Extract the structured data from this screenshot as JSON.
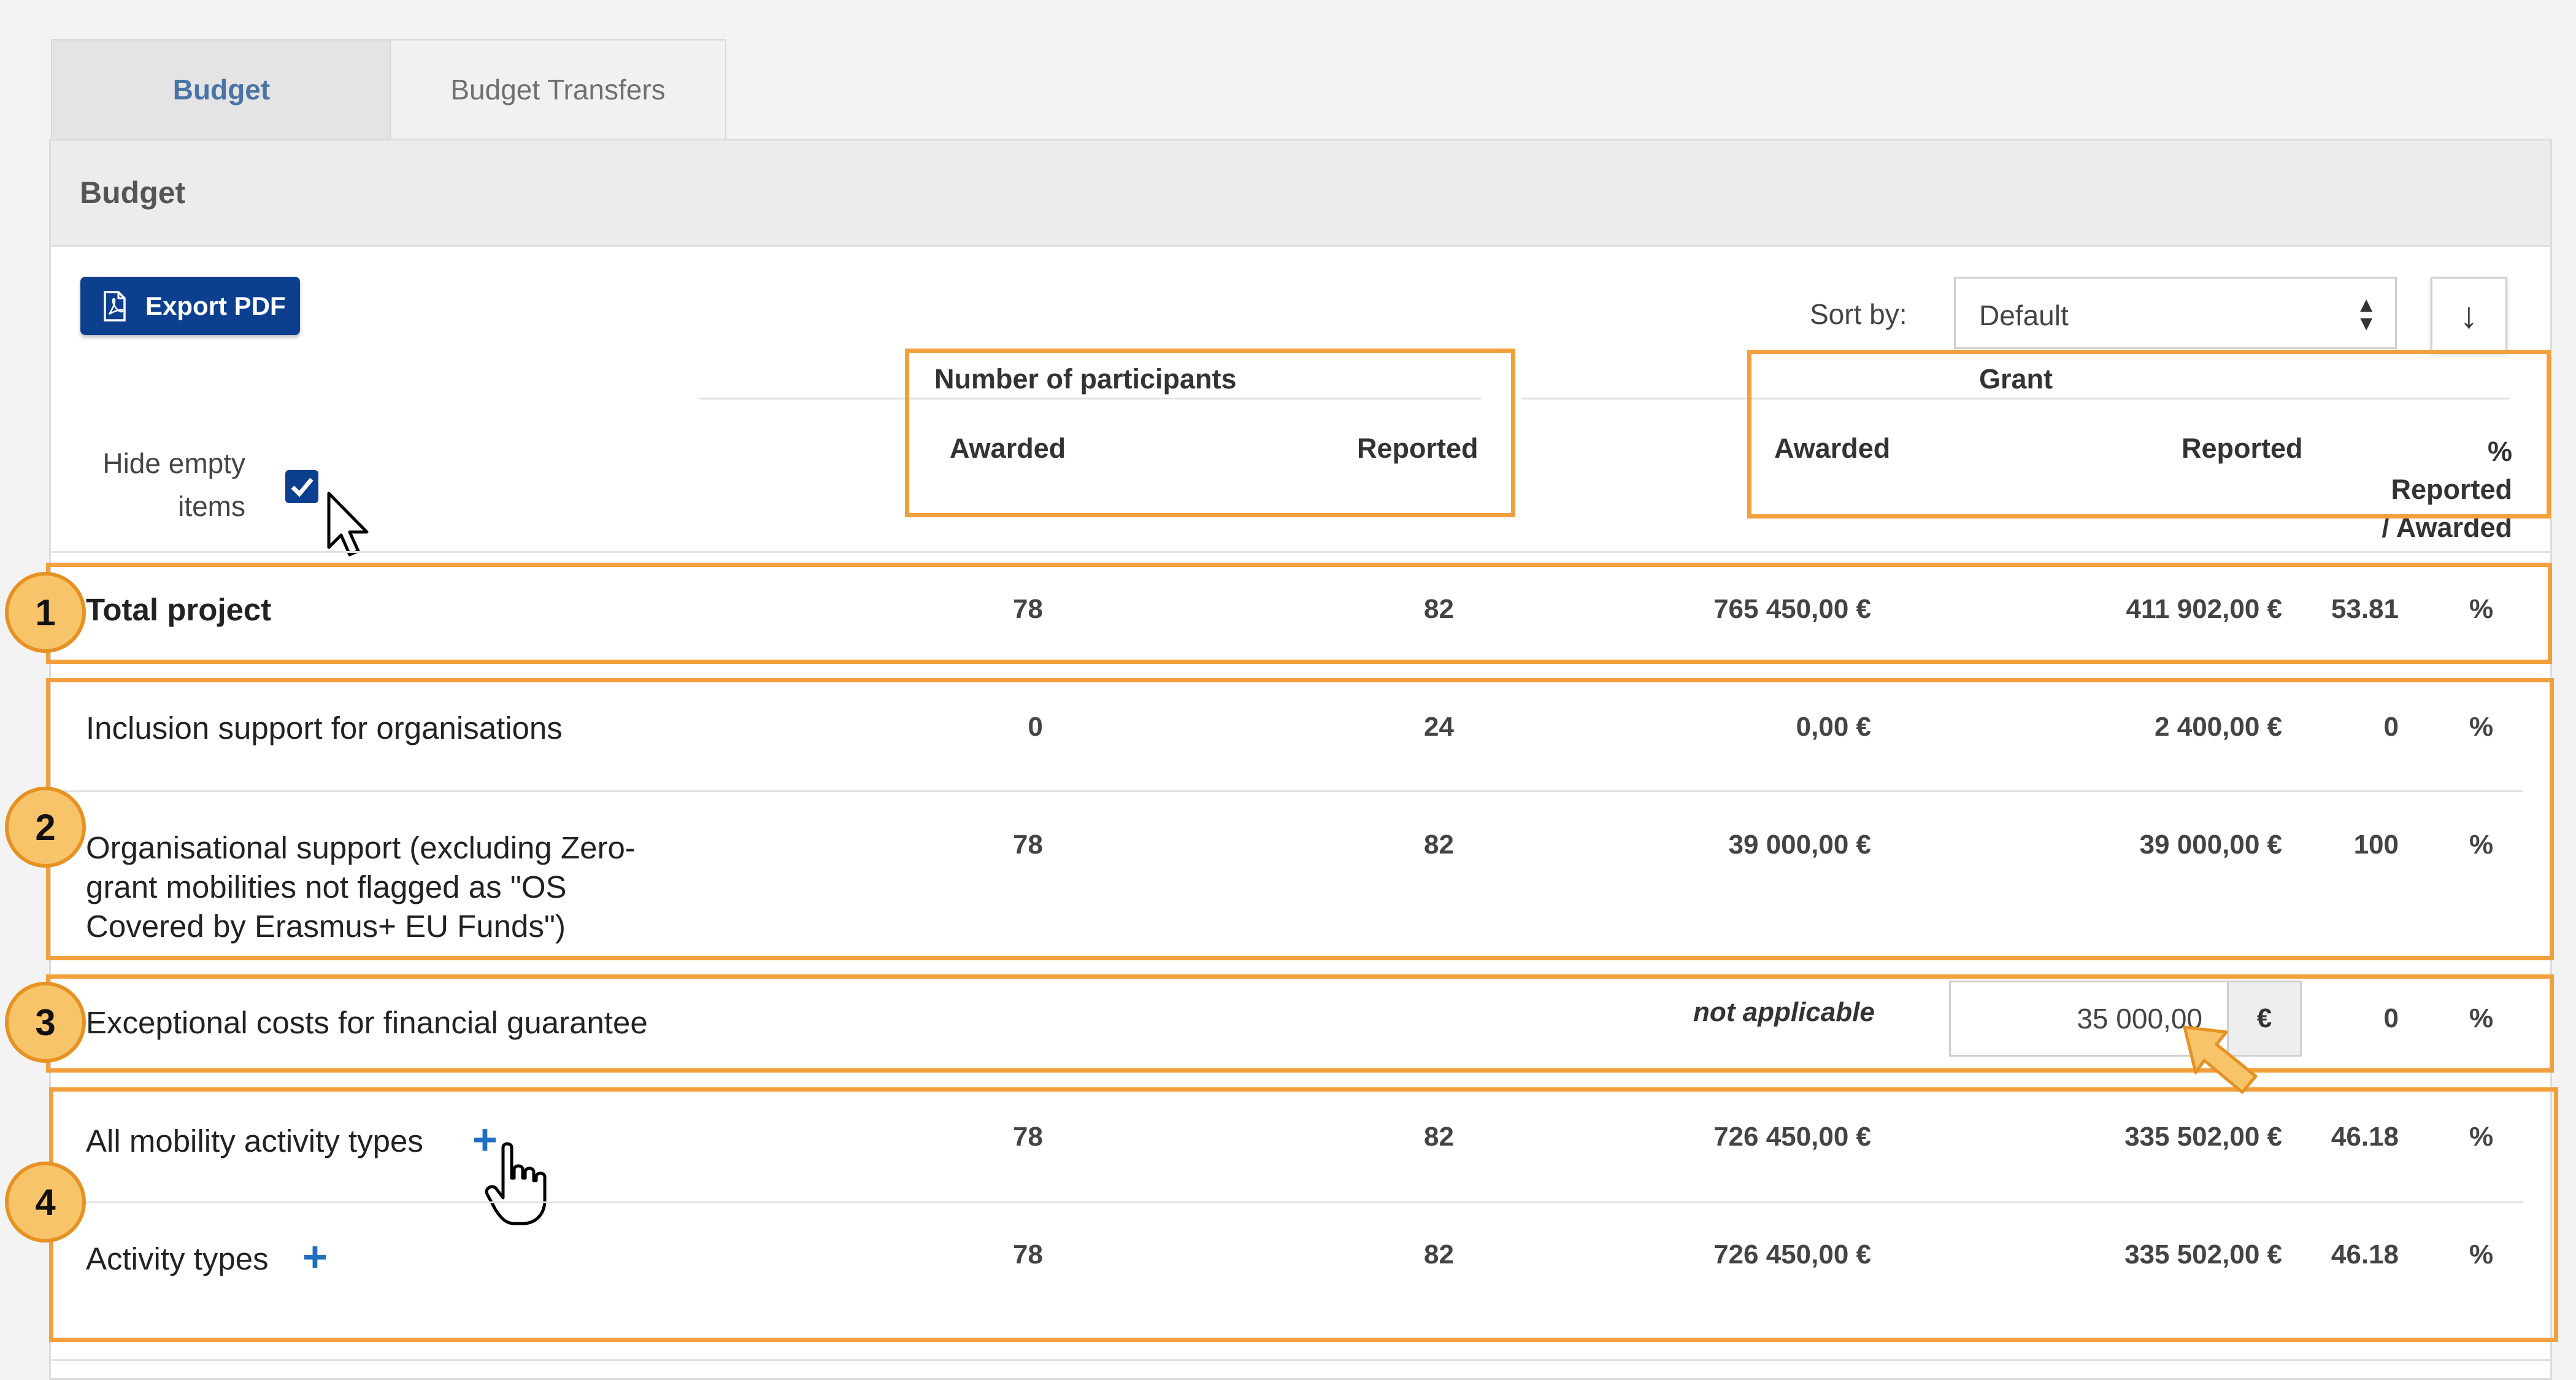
{
  "tabs": [
    {
      "label": "Budget",
      "active": true
    },
    {
      "label": "Budget Transfers",
      "active": false
    }
  ],
  "panel": {
    "title": "Budget"
  },
  "toolbar": {
    "export_label": "Export PDF",
    "sort_label": "Sort by:",
    "sort_value": "Default"
  },
  "filters": {
    "hide_empty_line1": "Hide empty",
    "hide_empty_line2": "items",
    "hide_empty_checked": true
  },
  "table": {
    "participants_group": "Number of participants",
    "grant_group": "Grant",
    "col_awarded": "Awarded",
    "col_reported": "Reported",
    "col_pct_line1": "% Reported",
    "col_pct_line2": "/ Awarded",
    "rows": [
      {
        "label": "Total project",
        "p_awarded": "78",
        "p_reported": "82",
        "g_awarded": "765 450,00 €",
        "g_reported": "411 902,00 €",
        "pct": "53.81",
        "pct_unit": "%"
      },
      {
        "label": "Inclusion support for organisations",
        "p_awarded": "0",
        "p_reported": "24",
        "g_awarded": "0,00 €",
        "g_reported": "2 400,00 €",
        "pct": "0",
        "pct_unit": "%"
      },
      {
        "label_line1": "Organisational support (excluding Zero-",
        "label_line2": "grant mobilities not flagged as \"OS",
        "label_line3": "Covered by Erasmus+ EU Funds\")",
        "p_awarded": "78",
        "p_reported": "82",
        "g_awarded": "39 000,00 €",
        "g_reported": "39 000,00 €",
        "pct": "100",
        "pct_unit": "%"
      },
      {
        "label": "Exceptional costs for financial guarantee",
        "g_awarded": "not applicable",
        "g_reported_input": "35 000,00",
        "currency": "€",
        "pct": "0",
        "pct_unit": "%"
      },
      {
        "label": "All mobility activity types",
        "p_awarded": "78",
        "p_reported": "82",
        "g_awarded": "726 450,00 €",
        "g_reported": "335 502,00 €",
        "pct": "46.18",
        "pct_unit": "%"
      },
      {
        "label": "Activity types",
        "p_awarded": "78",
        "p_reported": "82",
        "g_awarded": "726 450,00 €",
        "g_reported": "335 502,00 €",
        "pct": "46.18",
        "pct_unit": "%"
      }
    ]
  },
  "annotations": {
    "badge1": "1",
    "badge2": "2",
    "badge3": "3",
    "badge4": "4",
    "color": "#f1a03c"
  }
}
